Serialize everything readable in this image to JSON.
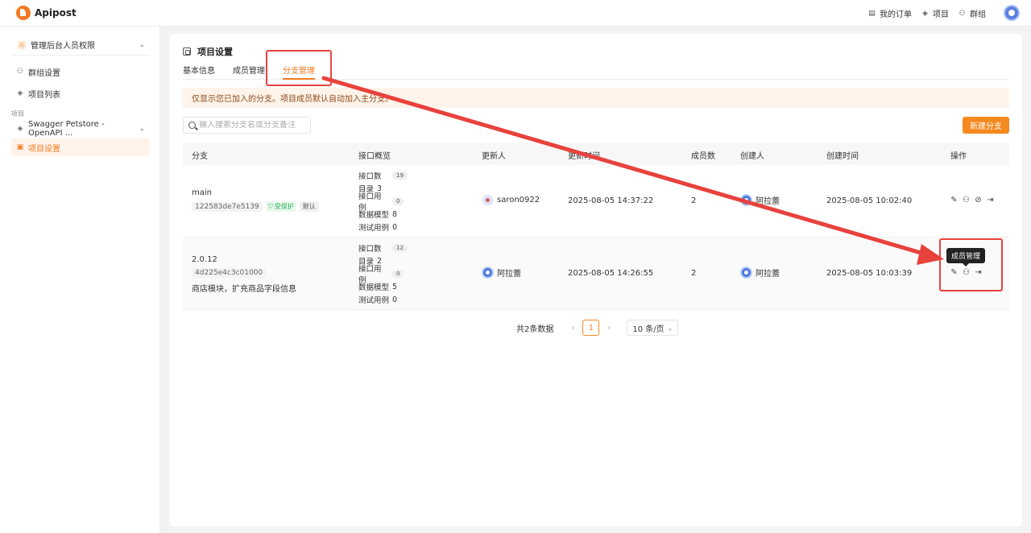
{
  "app": {
    "name": "Apipost"
  },
  "topnav": {
    "orders": "我的订单",
    "projects": "项目",
    "teams": "群组"
  },
  "sidebar": {
    "team": "管理后台人员权限",
    "items": [
      {
        "label": "群组设置"
      },
      {
        "label": "项目列表"
      }
    ],
    "section_label": "项目",
    "project": "Swagger Petstore - OpenAPI ...",
    "active_item": "项目设置"
  },
  "page": {
    "title": "项目设置",
    "tabs": [
      "基本信息",
      "成员管理",
      "分支管理"
    ],
    "active_tab": "分支管理",
    "notice": "仅显示您已加入的分支。项目成员默认自动加入主分支。",
    "search_placeholder": "输入搜索分支名或分支备注",
    "new_button": "新建分支"
  },
  "table": {
    "headers": [
      "分支",
      "接口概览",
      "更新人",
      "更新时间",
      "成员数",
      "创建人",
      "创建时间",
      "操作"
    ],
    "stat_labels": [
      "接口数",
      "目录",
      "接口用例",
      "数据模型",
      "测试用例"
    ],
    "rows": [
      {
        "name": "main",
        "hash": "122583de7e5139",
        "protected": "受保护",
        "default": "默认",
        "desc": "",
        "stats": [
          "19",
          "3",
          "0",
          "8",
          "0"
        ],
        "updater": "saron0922",
        "updated": "2025-08-05 14:37:22",
        "members": "2",
        "creator": "阿拉蕾",
        "created": "2025-08-05 10:02:40"
      },
      {
        "name": "2.0.12",
        "hash": "4d225e4c3c01000",
        "protected": "",
        "default": "",
        "desc": "商店模块，扩充商品字段信息",
        "stats": [
          "12",
          "2",
          "0",
          "5",
          "0"
        ],
        "updater": "阿拉蕾",
        "updated": "2025-08-05 14:26:55",
        "members": "2",
        "creator": "阿拉蕾",
        "created": "2025-08-05 10:03:39"
      }
    ]
  },
  "pagination": {
    "total": "共2条数据",
    "current": "1",
    "page_size": "10 条/页"
  },
  "tooltip": "成员管理",
  "colors": {
    "accent": "#f58a1f",
    "annotation": "#e8423d"
  }
}
